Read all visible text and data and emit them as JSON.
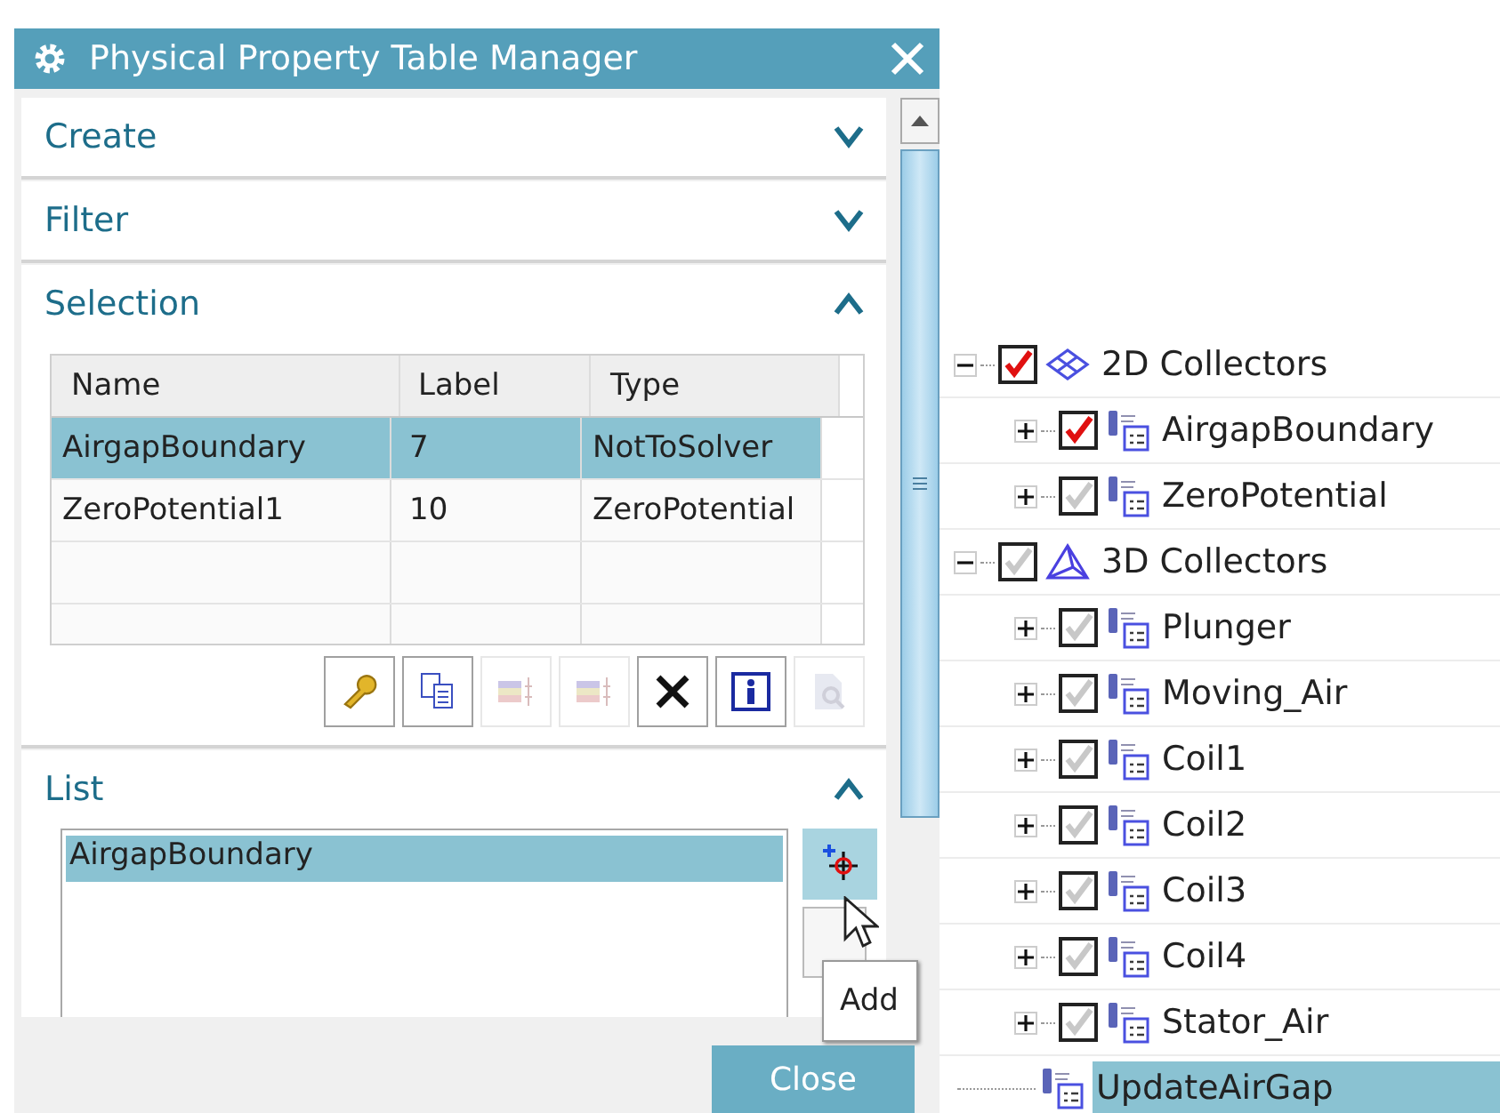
{
  "window": {
    "title": "Physical Property Table Manager"
  },
  "sections": [
    {
      "title": "Create",
      "expanded": false
    },
    {
      "title": "Filter",
      "expanded": false
    },
    {
      "title": "Selection",
      "expanded": true
    },
    {
      "title": "List",
      "expanded": true
    }
  ],
  "table": {
    "columns": [
      "Name",
      "Label",
      "Type"
    ],
    "rows": [
      {
        "cells": [
          "AirgapBoundary",
          "7",
          "NotToSolver"
        ],
        "selected": true
      },
      {
        "cells": [
          "ZeroPotential1",
          "10",
          "ZeroPotential"
        ],
        "selected": false
      }
    ]
  },
  "toolbar": [
    {
      "kind": "edit",
      "disabled": false
    },
    {
      "kind": "copy",
      "disabled": false
    },
    {
      "kind": "stack",
      "disabled": true
    },
    {
      "kind": "stack3d",
      "disabled": true
    },
    {
      "kind": "delete",
      "disabled": false
    },
    {
      "kind": "info",
      "disabled": false
    },
    {
      "kind": "inspect",
      "disabled": true
    }
  ],
  "list": {
    "items": [
      {
        "label": "AirgapBoundary",
        "selected": true
      }
    ]
  },
  "tooltip": "Add",
  "close_button": "Close",
  "tree": [
    {
      "label": "2D Collectors",
      "kind": "mesh2d",
      "expanded": true,
      "checked": true,
      "selected": false,
      "children": [
        {
          "label": "AirgapBoundary",
          "kind": "group",
          "expanded": false,
          "checked": true,
          "selected": false
        },
        {
          "label": "ZeroPotential",
          "kind": "group",
          "expanded": false,
          "checked": false,
          "selected": false
        }
      ]
    },
    {
      "label": "3D Collectors",
      "kind": "mesh3d",
      "expanded": true,
      "checked": false,
      "selected": false,
      "children": [
        {
          "label": "Plunger",
          "kind": "group",
          "expanded": false,
          "checked": false,
          "selected": false
        },
        {
          "label": "Moving_Air",
          "kind": "group",
          "expanded": false,
          "checked": false,
          "selected": false
        },
        {
          "label": "Coil1",
          "kind": "group",
          "expanded": false,
          "checked": false,
          "selected": false
        },
        {
          "label": "Coil2",
          "kind": "group",
          "expanded": false,
          "checked": false,
          "selected": false
        },
        {
          "label": "Coil3",
          "kind": "group",
          "expanded": false,
          "checked": false,
          "selected": false
        },
        {
          "label": "Coil4",
          "kind": "group",
          "expanded": false,
          "checked": false,
          "selected": false
        },
        {
          "label": "Stator_Air",
          "kind": "group",
          "expanded": false,
          "checked": false,
          "selected": false
        }
      ]
    },
    {
      "label": "UpdateAirGap",
      "kind": "field",
      "selected": true
    }
  ]
}
